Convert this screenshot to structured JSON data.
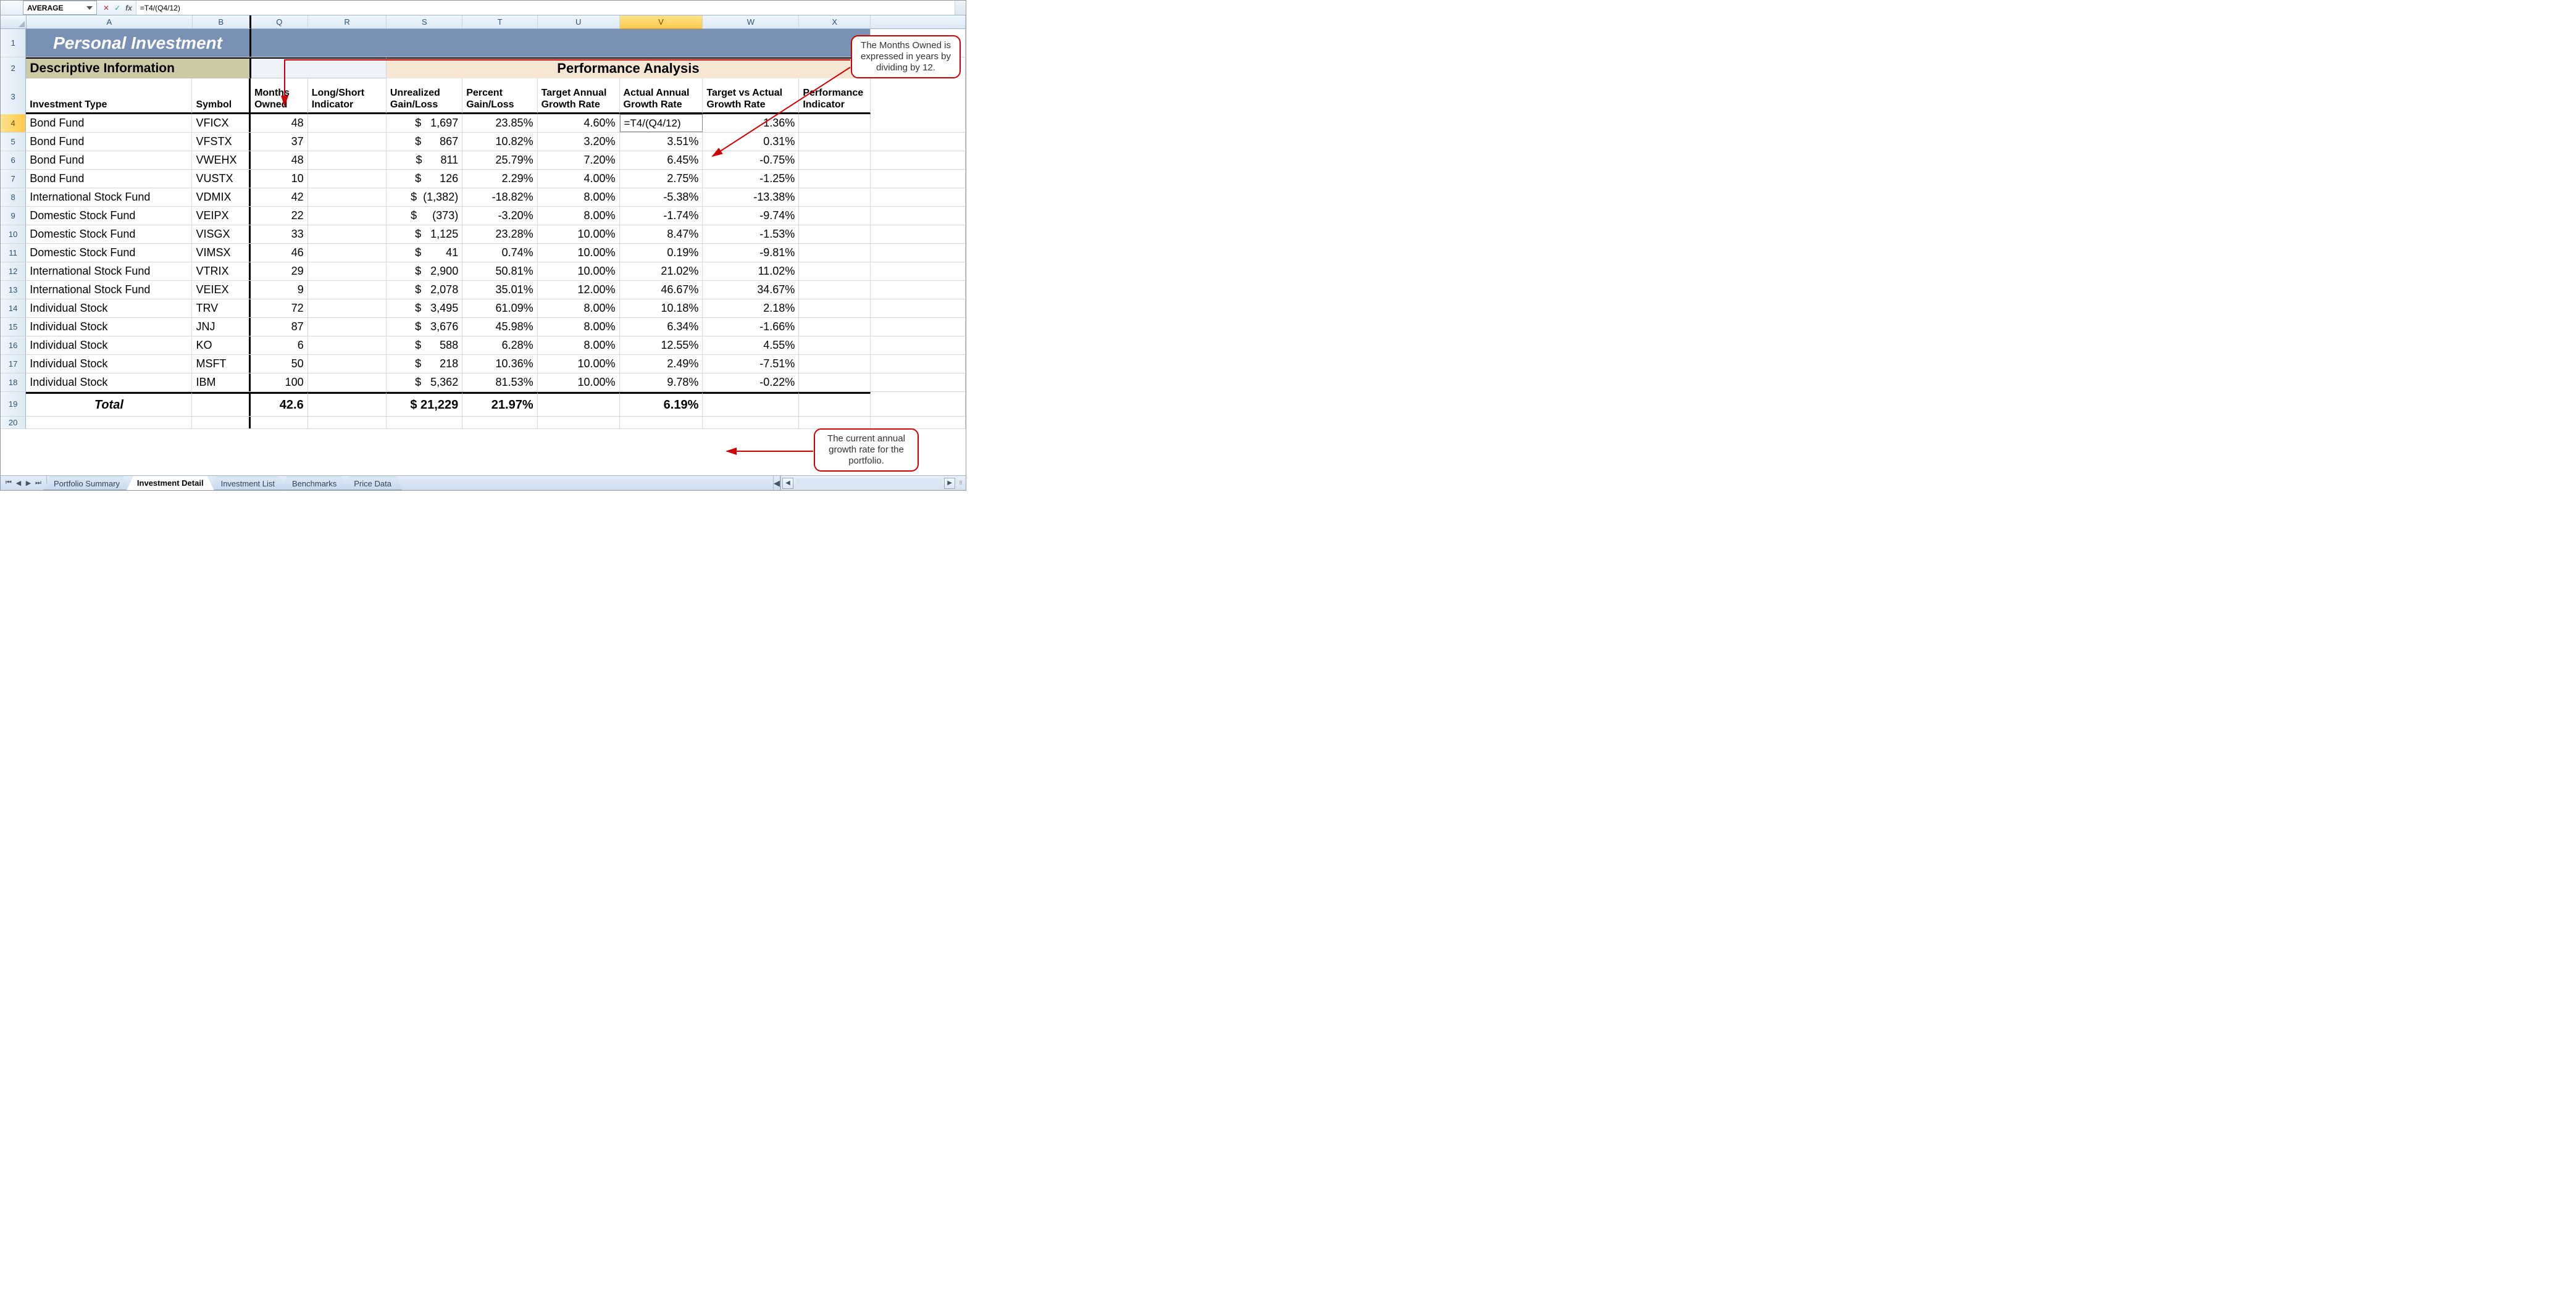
{
  "formula_bar": {
    "name_box": "AVERAGE",
    "formula": "=T4/(Q4/12)"
  },
  "col_headers": [
    "A",
    "B",
    "Q",
    "R",
    "S",
    "T",
    "U",
    "V",
    "W",
    "X"
  ],
  "active_col": "V",
  "row_headers": [
    "1",
    "2",
    "3",
    "4",
    "5",
    "6",
    "7",
    "8",
    "9",
    "10",
    "11",
    "12",
    "13",
    "14",
    "15",
    "16",
    "17",
    "18",
    "19",
    "20"
  ],
  "active_row": "4",
  "titles": {
    "main": "Personal Investment",
    "desc": "Descriptive Information",
    "perf": "Performance Analysis"
  },
  "col3": {
    "A": "Investment Type",
    "B": "Symbol",
    "Q": "Months Owned",
    "R": "Long/Short Indicator",
    "S": "Unrealized Gain/Loss",
    "T": "Percent Gain/Loss",
    "U": "Target Annual Growth Rate",
    "V": "Actual Annual Growth Rate",
    "W": "Target vs Actual Growth Rate",
    "X": "Performance Indicator"
  },
  "rows": [
    {
      "r": "4",
      "A": "Bond Fund",
      "B": "VFICX",
      "Q": "48",
      "S": "$   1,697",
      "T": "23.85%",
      "U": "4.60%",
      "V": "=T4/(Q4/12)",
      "W": "1.36%"
    },
    {
      "r": "5",
      "A": "Bond Fund",
      "B": "VFSTX",
      "Q": "37",
      "S": "$      867",
      "T": "10.82%",
      "U": "3.20%",
      "V": "3.51%",
      "W": "0.31%"
    },
    {
      "r": "6",
      "A": "Bond Fund",
      "B": "VWEHX",
      "Q": "48",
      "S": "$      811",
      "T": "25.79%",
      "U": "7.20%",
      "V": "6.45%",
      "W": "-0.75%"
    },
    {
      "r": "7",
      "A": "Bond Fund",
      "B": "VUSTX",
      "Q": "10",
      "S": "$      126",
      "T": "2.29%",
      "U": "4.00%",
      "V": "2.75%",
      "W": "-1.25%"
    },
    {
      "r": "8",
      "A": "International Stock Fund",
      "B": "VDMIX",
      "Q": "42",
      "S": "$  (1,382)",
      "T": "-18.82%",
      "U": "8.00%",
      "V": "-5.38%",
      "W": "-13.38%"
    },
    {
      "r": "9",
      "A": "Domestic Stock Fund",
      "B": "VEIPX",
      "Q": "22",
      "S": "$     (373)",
      "T": "-3.20%",
      "U": "8.00%",
      "V": "-1.74%",
      "W": "-9.74%"
    },
    {
      "r": "10",
      "A": "Domestic Stock Fund",
      "B": "VISGX",
      "Q": "33",
      "S": "$   1,125",
      "T": "23.28%",
      "U": "10.00%",
      "V": "8.47%",
      "W": "-1.53%"
    },
    {
      "r": "11",
      "A": "Domestic Stock Fund",
      "B": "VIMSX",
      "Q": "46",
      "S": "$        41",
      "T": "0.74%",
      "U": "10.00%",
      "V": "0.19%",
      "W": "-9.81%"
    },
    {
      "r": "12",
      "A": "International Stock Fund",
      "B": "VTRIX",
      "Q": "29",
      "S": "$   2,900",
      "T": "50.81%",
      "U": "10.00%",
      "V": "21.02%",
      "W": "11.02%"
    },
    {
      "r": "13",
      "A": "International Stock Fund",
      "B": "VEIEX",
      "Q": "9",
      "S": "$   2,078",
      "T": "35.01%",
      "U": "12.00%",
      "V": "46.67%",
      "W": "34.67%"
    },
    {
      "r": "14",
      "A": "Individual Stock",
      "B": "TRV",
      "Q": "72",
      "S": "$   3,495",
      "T": "61.09%",
      "U": "8.00%",
      "V": "10.18%",
      "W": "2.18%"
    },
    {
      "r": "15",
      "A": "Individual Stock",
      "B": "JNJ",
      "Q": "87",
      "S": "$   3,676",
      "T": "45.98%",
      "U": "8.00%",
      "V": "6.34%",
      "W": "-1.66%"
    },
    {
      "r": "16",
      "A": "Individual Stock",
      "B": "KO",
      "Q": "6",
      "S": "$      588",
      "T": "6.28%",
      "U": "8.00%",
      "V": "12.55%",
      "W": "4.55%"
    },
    {
      "r": "17",
      "A": "Individual Stock",
      "B": "MSFT",
      "Q": "50",
      "S": "$      218",
      "T": "10.36%",
      "U": "10.00%",
      "V": "2.49%",
      "W": "-7.51%"
    },
    {
      "r": "18",
      "A": "Individual Stock",
      "B": "IBM",
      "Q": "100",
      "S": "$   5,362",
      "T": "81.53%",
      "U": "10.00%",
      "V": "9.78%",
      "W": "-0.22%"
    }
  ],
  "totals": {
    "label": "Total",
    "Q": "42.6",
    "S": "$ 21,229",
    "T": "21.97%",
    "V": "6.19%"
  },
  "tabs": [
    "Portfolio Summary",
    "Investment Detail",
    "Investment List",
    "Benchmarks",
    "Price Data"
  ],
  "active_tab": "Investment Detail",
  "callouts": {
    "top": "The Months Owned is expressed in years by dividing by 12.",
    "bottom": "The current annual growth rate for the portfolio."
  }
}
